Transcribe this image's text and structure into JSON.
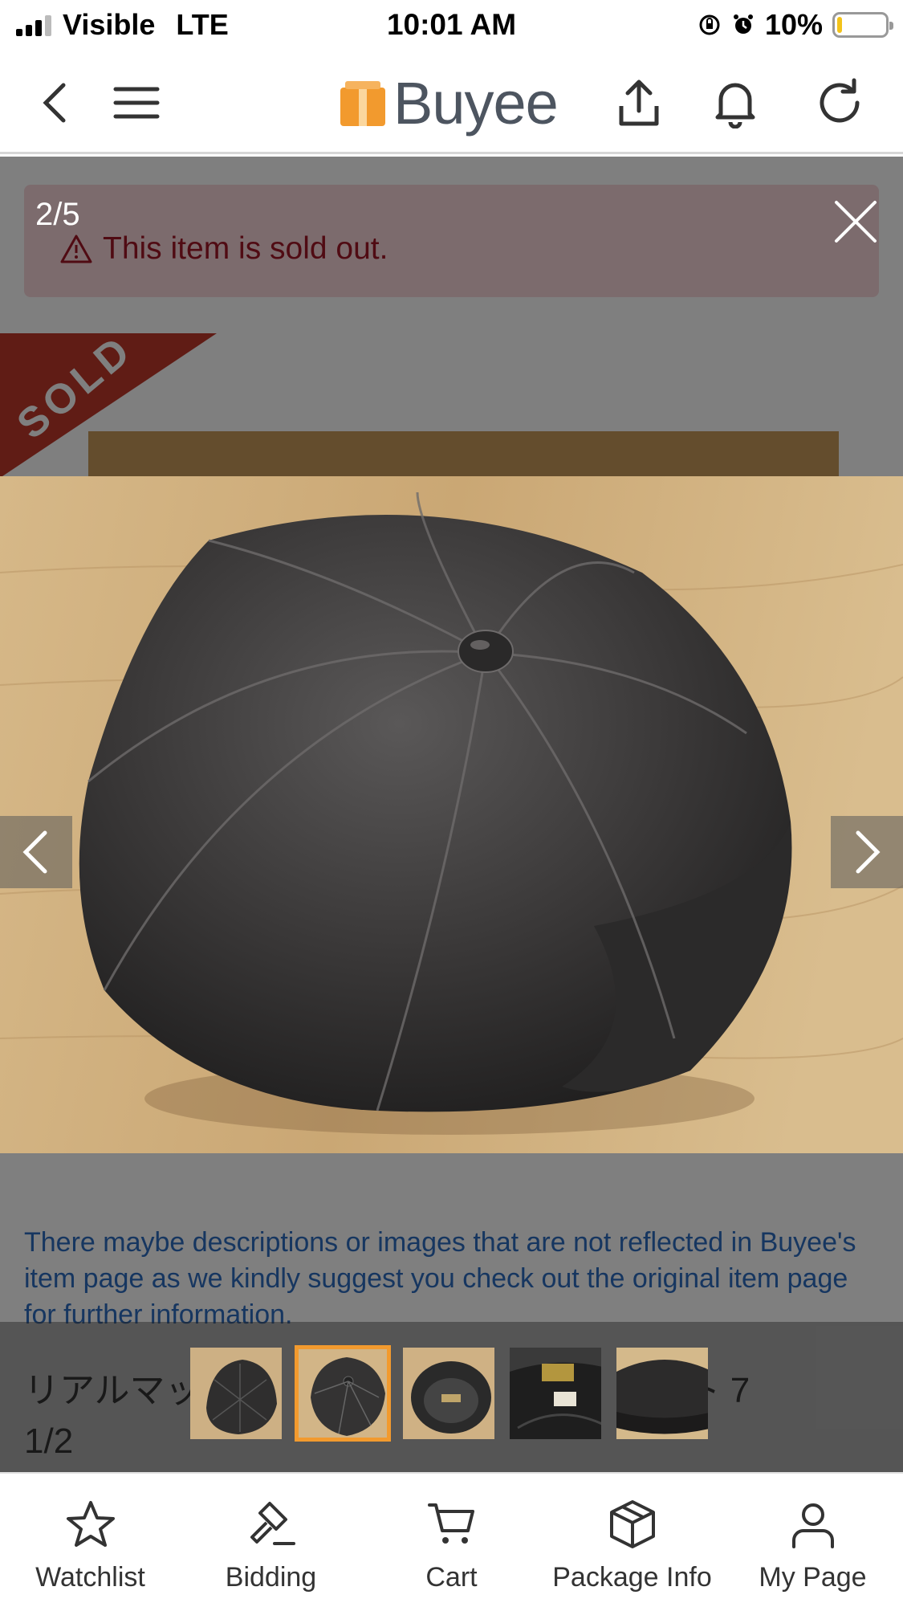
{
  "status_bar": {
    "carrier": "Visible",
    "network": "LTE",
    "time": "10:01 AM",
    "battery_percent": "10%",
    "battery_level": 0.1
  },
  "header": {
    "logo_text": "Buyee",
    "icons": [
      "back-icon",
      "menu-icon",
      "share-icon",
      "bell-icon",
      "refresh-icon"
    ]
  },
  "alert": {
    "message": "This item is sold out."
  },
  "sold_banner": "SOLD",
  "viewer": {
    "counter": "2/5",
    "current_index": 2,
    "total": 5,
    "thumbnails": [
      {
        "label": "thumbnail-1",
        "active": false
      },
      {
        "label": "thumbnail-2",
        "active": true
      },
      {
        "label": "thumbnail-3",
        "active": false
      },
      {
        "label": "thumbnail-4",
        "active": false
      },
      {
        "label": "thumbnail-5",
        "active": false
      }
    ]
  },
  "page": {
    "note": "There maybe descriptions or images that are not reflected in Buyee's item page as we kindly suggest you check out the original item page for further information.",
    "item_title_start": "リアルマッ",
    "item_title_end": "ット 7",
    "item_title_line2": "1/2"
  },
  "tabbar": {
    "items": [
      {
        "label": "Watchlist",
        "icon": "star-icon"
      },
      {
        "label": "Bidding",
        "icon": "gavel-icon"
      },
      {
        "label": "Cart",
        "icon": "cart-icon"
      },
      {
        "label": "Package Info",
        "icon": "package-icon"
      },
      {
        "label": "My Page",
        "icon": "user-icon"
      }
    ]
  },
  "colors": {
    "brand_orange": "#f29a2e",
    "logo_gray": "#4d5560",
    "alert_text": "#a11627",
    "link_blue": "#2d6cc0",
    "sold_red": "#c0392b"
  }
}
